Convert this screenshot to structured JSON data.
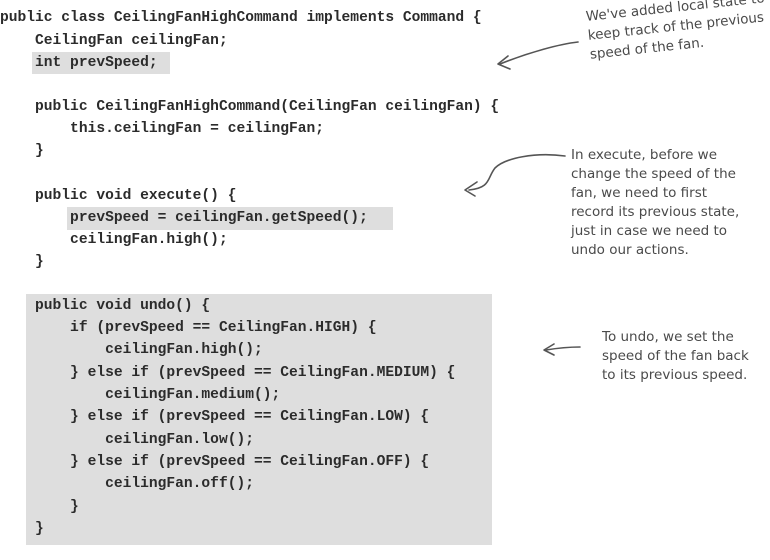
{
  "code": {
    "lines": [
      "public class CeilingFanHighCommand implements Command {",
      "    CeilingFan ceilingFan;",
      "    int prevSpeed;",
      "",
      "    public CeilingFanHighCommand(CeilingFan ceilingFan) {",
      "        this.ceilingFan = ceilingFan;",
      "    }",
      "",
      "    public void execute() {",
      "        prevSpeed = ceilingFan.getSpeed();",
      "        ceilingFan.high();",
      "    }",
      "",
      "    public void undo() {",
      "        if (prevSpeed == CeilingFan.HIGH) {",
      "            ceilingFan.high();",
      "        } else if (prevSpeed == CeilingFan.MEDIUM) {",
      "            ceilingFan.medium();",
      "        } else if (prevSpeed == CeilingFan.LOW) {",
      "            ceilingFan.low();",
      "        } else if (prevSpeed == CeilingFan.OFF) {",
      "            ceilingFan.off();",
      "        }",
      "    }",
      "}"
    ],
    "highlight_color": "#dedede"
  },
  "annotations": [
    {
      "text": "We've added local state to\nkeep track of the previous\nspeed of the fan.",
      "points_to": "int prevSpeed;"
    },
    {
      "text": "In execute, before we\nchange the speed of the\nfan, we need to first\nrecord its previous state,\njust in case we need to\nundo our actions.",
      "points_to": "prevSpeed = ceilingFan.getSpeed();"
    },
    {
      "text": "To undo, we set the\nspeed of the fan back\nto its previous speed.",
      "points_to": "public void undo()"
    }
  ]
}
